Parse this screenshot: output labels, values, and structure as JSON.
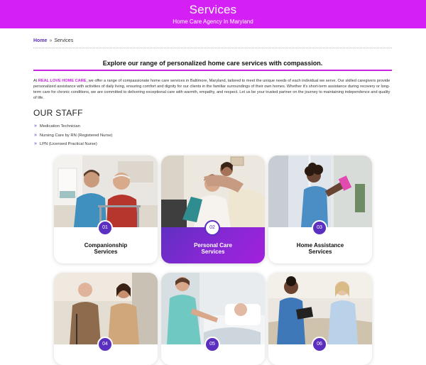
{
  "header": {
    "title": "Services",
    "subtitle": "Home Care Agency In Maryland",
    "background_color": "#d41ff5"
  },
  "breadcrumb": {
    "home": "Home",
    "separator": "»",
    "current": "Services"
  },
  "tagline": "Explore our range of personalized home care services with compassion.",
  "intro": {
    "brand": "REAL LOVE HOME CARE",
    "text_before": "At ",
    "text_after": ", we offer a range of compassionate home care services in Baltimore, Maryland, tailored to meet the unique needs of each individual we serve. Our skilled caregivers provide personalized assistance with activities of daily living, ensuring comfort and dignity for our clients in the familiar surroundings of their own homes. Whether it's short-term assistance during recovery or long-term care for chronic conditions, we are committed to delivering exceptional care with warmth, empathy, and respect. Let us be your trusted partner on the journey to maintaining independence and quality of life."
  },
  "staff": {
    "title": "OUR STAFF",
    "bullet_icon": "double-chevron-right-icon",
    "items": [
      "Medication Technician",
      "Nursing Care by RN (Registered Nurse)",
      "LPN (Licensed Practical Nurse)"
    ]
  },
  "services": [
    {
      "number": "01",
      "line1": "Companionship",
      "line2": "Services",
      "active": false
    },
    {
      "number": "02",
      "line1": "Personal Care",
      "line2": "Services",
      "active": true
    },
    {
      "number": "03",
      "line1": "Home Assistance",
      "line2": "Services",
      "active": false
    },
    {
      "number": "04",
      "line1": "",
      "line2": "",
      "active": false
    },
    {
      "number": "05",
      "line1": "",
      "line2": "",
      "active": false
    },
    {
      "number": "06",
      "line1": "",
      "line2": "",
      "active": false
    }
  ],
  "colors": {
    "accent_magenta": "#c923e0",
    "accent_purple": "#5b2fbf"
  }
}
